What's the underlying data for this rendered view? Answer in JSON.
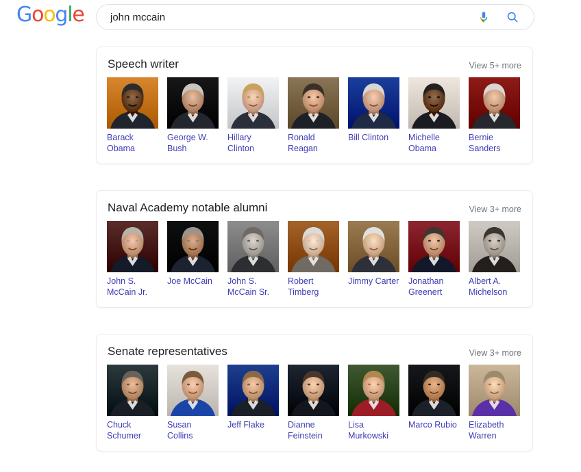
{
  "brand": {
    "logo_letters": [
      "G",
      "o",
      "o",
      "g",
      "l",
      "e"
    ],
    "colors": {
      "blue": "#4285f4",
      "red": "#ea4335",
      "yellow": "#fbbc05",
      "green": "#34a853",
      "link": "#3c3cb4",
      "muted": "#70757a",
      "text": "#202124"
    }
  },
  "search": {
    "value": "john mccain",
    "placeholder": "Search",
    "mic_icon": "microphone-icon",
    "search_icon": "search-icon"
  },
  "carousels": [
    {
      "title": "Speech writer",
      "view_more": "View 5+ more",
      "items": [
        {
          "name": "Barack Obama",
          "photo": "obama"
        },
        {
          "name": "George W. Bush",
          "photo": "bush"
        },
        {
          "name": "Hillary Clinton",
          "photo": "hillary"
        },
        {
          "name": "Ronald Reagan",
          "photo": "reagan"
        },
        {
          "name": "Bill Clinton",
          "photo": "billclinton"
        },
        {
          "name": "Michelle Obama",
          "photo": "michelle"
        },
        {
          "name": "Bernie Sanders",
          "photo": "bernie"
        }
      ]
    },
    {
      "title": "Naval Academy notable alumni",
      "view_more": "View 3+ more",
      "items": [
        {
          "name": "John S. McCain Jr.",
          "photo": "mccainjr"
        },
        {
          "name": "Joe McCain",
          "photo": "joemccain"
        },
        {
          "name": "John S. McCain Sr.",
          "photo": "mccainsr"
        },
        {
          "name": "Robert Timberg",
          "photo": "timberg"
        },
        {
          "name": "Jimmy Carter",
          "photo": "carter"
        },
        {
          "name": "Jonathan Greenert",
          "photo": "greenert"
        },
        {
          "name": "Albert A. Michelson",
          "photo": "michelson"
        }
      ]
    },
    {
      "title": "Senate representatives",
      "view_more": "View 3+ more",
      "items": [
        {
          "name": "Chuck Schumer",
          "photo": "schumer"
        },
        {
          "name": "Susan Collins",
          "photo": "collins"
        },
        {
          "name": "Jeff Flake",
          "photo": "flake"
        },
        {
          "name": "Dianne Feinstein",
          "photo": "feinstein"
        },
        {
          "name": "Lisa Murkowski",
          "photo": "murkowski"
        },
        {
          "name": "Marco Rubio",
          "photo": "rubio"
        },
        {
          "name": "Elizabeth Warren",
          "photo": "warren"
        }
      ]
    }
  ]
}
